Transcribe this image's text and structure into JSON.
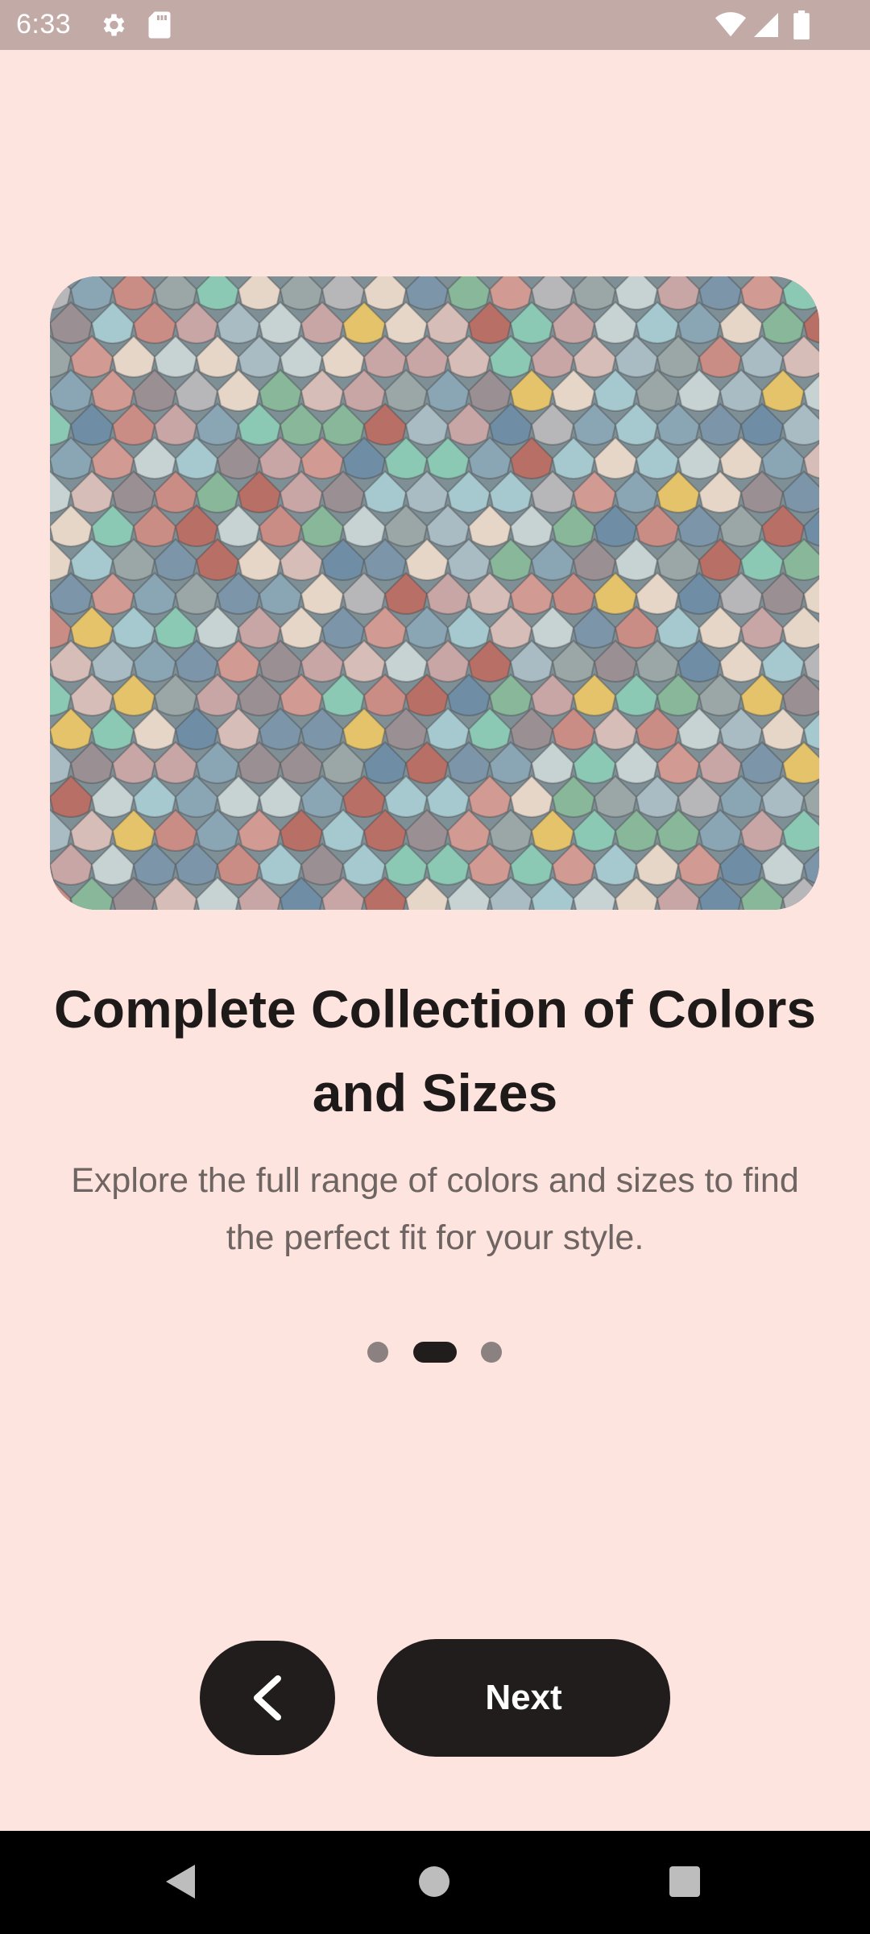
{
  "status_bar": {
    "time": "6:33",
    "icons": [
      "gear-icon",
      "sd-card-icon",
      "wifi-icon",
      "cell-signal-icon",
      "battery-icon"
    ]
  },
  "hero": {
    "image": "hero-tiles-image"
  },
  "onboarding": {
    "title": "Complete Collection of Colors and Sizes",
    "subtitle": "Explore the full range of colors and sizes to find the perfect fit for your style.",
    "page_indicator": {
      "total": 3,
      "current": 2
    }
  },
  "buttons": {
    "back_icon": "chevron-left-icon",
    "next_label": "Next"
  },
  "nav_bar": {
    "icons": [
      "nav-back-icon",
      "nav-home-icon",
      "nav-recents-icon"
    ]
  },
  "colors": {
    "background": "#fde4de",
    "status_bar": "#c2aba7",
    "button": "#221d1d",
    "title": "#1f1a1a",
    "subtitle": "#6e6563",
    "dot_inactive": "#8a8180"
  }
}
